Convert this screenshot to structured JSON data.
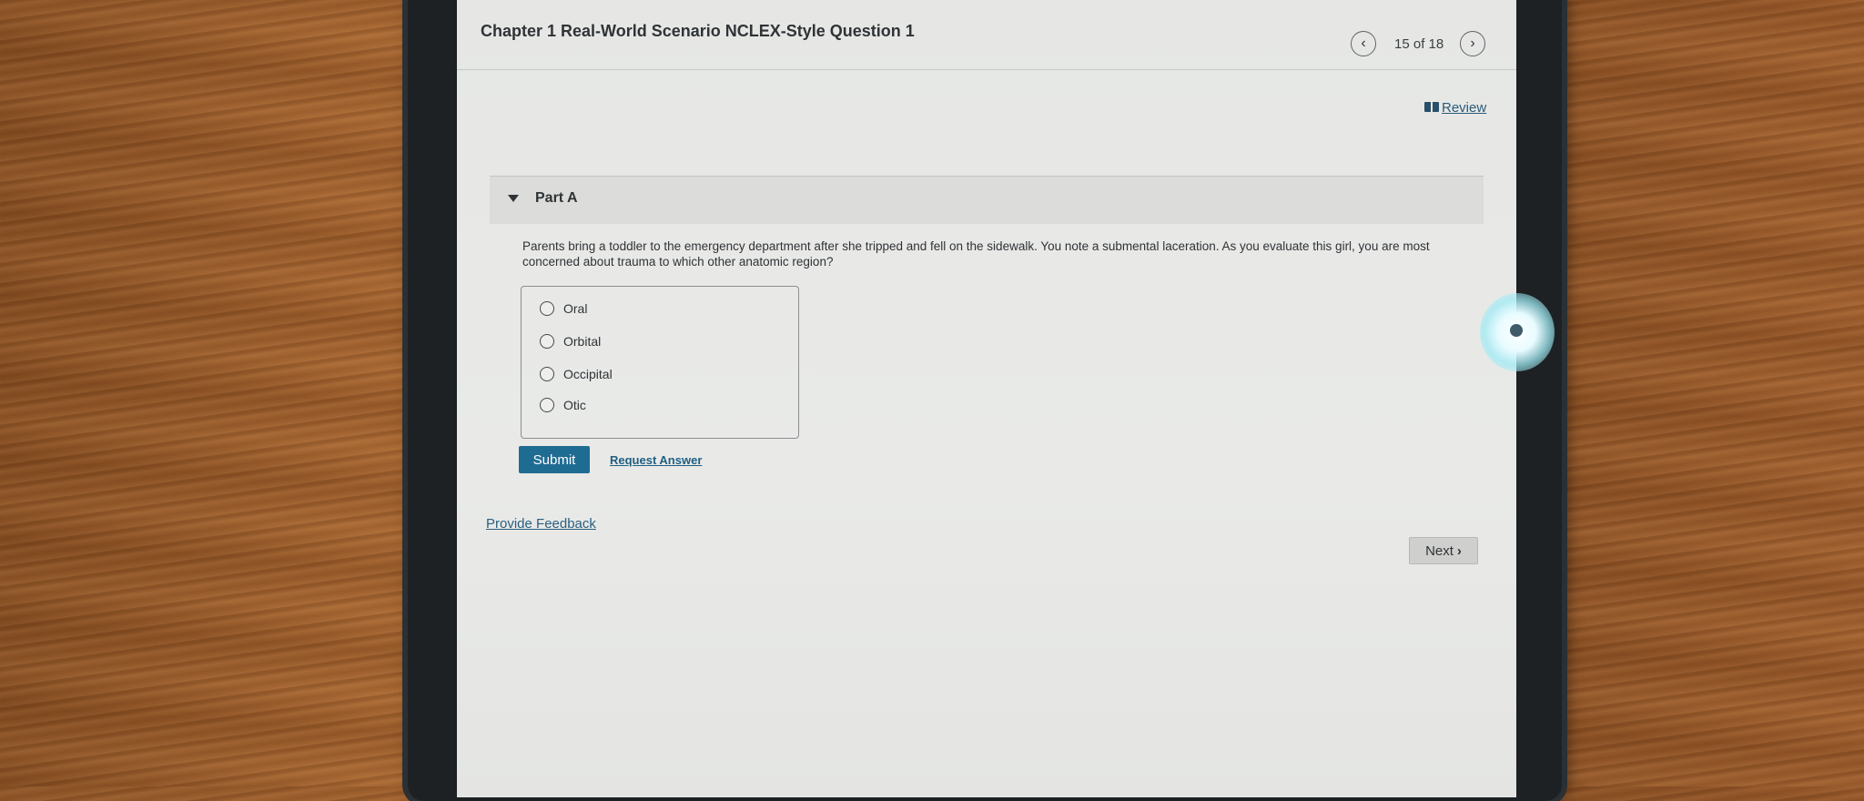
{
  "header": {
    "question_title": "Chapter 1 Real-World Scenario NCLEX-Style Question 1",
    "counter": "15 of 18",
    "prev_icon": "chevron-left-icon",
    "next_icon": "chevron-right-icon"
  },
  "review": {
    "label": "Review",
    "icon": "book-icon"
  },
  "part": {
    "label": "Part A",
    "toggle_icon": "caret-down-icon"
  },
  "question_text": "Parents bring a toddler to the emergency department after she tripped and fell on the sidewalk. You note a submental laceration. As you evaluate this girl, you are most concerned about trauma to which other anatomic region?",
  "options": [
    "Oral",
    "Orbital",
    "Occipital",
    "Otic"
  ],
  "actions": {
    "submit_label": "Submit",
    "request_answer_label": "Request Answer"
  },
  "feedback_label": "Provide Feedback",
  "next_label": "Next",
  "colors": {
    "submit_bg": "#1f6c93",
    "link": "#1f5e82"
  }
}
